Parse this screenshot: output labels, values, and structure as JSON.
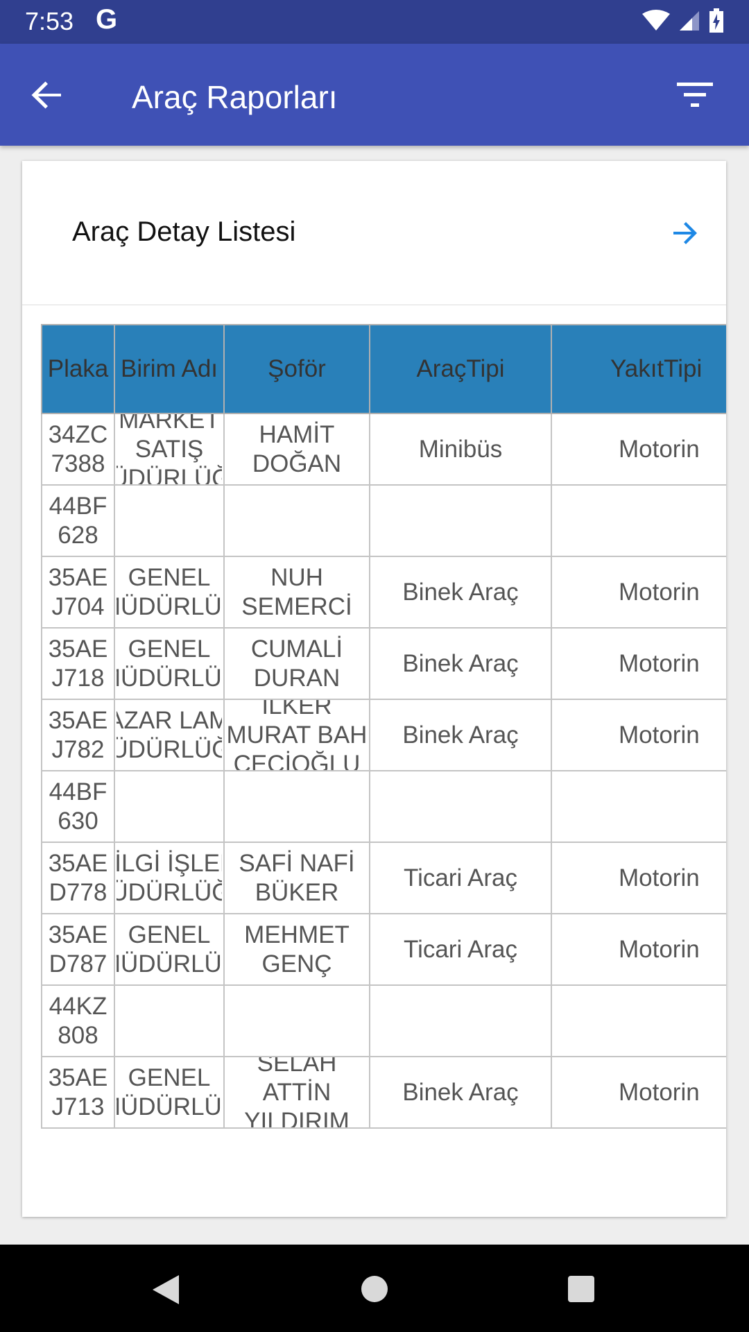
{
  "status_bar": {
    "time": "7:53",
    "g_label": "G",
    "icons": [
      "wifi-icon",
      "signal-icon",
      "battery-icon"
    ]
  },
  "app_bar": {
    "title": "Araç Raporları",
    "back_icon": "arrow-back-icon",
    "filter_icon": "filter-icon"
  },
  "card": {
    "title": "Araç Detay Listesi",
    "arrow_icon": "arrow-forward-icon"
  },
  "table": {
    "headers": [
      "Plaka",
      "Birim Adı",
      "Şoför",
      "AraçTipi",
      "YakıtTipi"
    ],
    "rows": [
      {
        "plaka": "34ZC 7388",
        "birim": "MARKET SATIŞ MÜDÜRLÜĞÜ",
        "sofor": "HAMİT DOĞAN",
        "arac_tipi": "Minibüs",
        "yakit_tipi": "Motorin"
      },
      {
        "plaka": "44BF 628",
        "birim": "",
        "sofor": "",
        "arac_tipi": "",
        "yakit_tipi": ""
      },
      {
        "plaka": "35AE J704",
        "birim": "GENEL MÜDÜRLÜK",
        "sofor": "NUH SEMERCİ",
        "arac_tipi": "Binek Araç",
        "yakit_tipi": "Motorin"
      },
      {
        "plaka": "35AE J718",
        "birim": "GENEL MÜDÜRLÜK",
        "sofor": "CUMALİ DURAN",
        "arac_tipi": "Binek Araç",
        "yakit_tipi": "Motorin"
      },
      {
        "plaka": "35AE J782",
        "birim": "PAZAR LAMA MÜDÜRLÜĞÜ",
        "sofor": "İLKER MURAT BAH ÇECİOĞLU",
        "arac_tipi": "Binek Araç",
        "yakit_tipi": "Motorin"
      },
      {
        "plaka": "44BF 630",
        "birim": "",
        "sofor": "",
        "arac_tipi": "",
        "yakit_tipi": ""
      },
      {
        "plaka": "35AE D778",
        "birim": "BİLGİ İŞLEM MÜDÜRLÜĞÜ",
        "sofor": "SAFİ NAFİ BÜKER",
        "arac_tipi": "Ticari Araç",
        "yakit_tipi": "Motorin"
      },
      {
        "plaka": "35AE D787",
        "birim": "GENEL MÜDÜRLÜK",
        "sofor": "MEHMET GENÇ",
        "arac_tipi": "Ticari Araç",
        "yakit_tipi": "Motorin"
      },
      {
        "plaka": "44KZ 808",
        "birim": "",
        "sofor": "",
        "arac_tipi": "",
        "yakit_tipi": ""
      },
      {
        "plaka": "35AE J713",
        "birim": "GENEL MÜDÜRLÜK",
        "sofor": "SELAH ATTİN YILDIRIM",
        "arac_tipi": "Binek Araç",
        "yakit_tipi": "Motorin"
      }
    ]
  },
  "nav_bar": {
    "icons": [
      "nav-back-icon",
      "nav-home-icon",
      "nav-recents-icon"
    ]
  }
}
